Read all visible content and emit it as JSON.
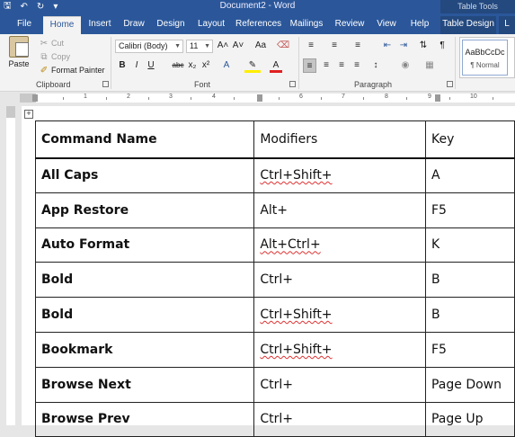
{
  "titlebar": {
    "doc_title": "Document2 - Word",
    "context_label": "Table Tools",
    "qat": [
      "save-icon",
      "undo-icon",
      "redo-icon",
      "customize-icon"
    ]
  },
  "tabs": [
    {
      "label": "File"
    },
    {
      "label": "Home",
      "active": true
    },
    {
      "label": "Insert"
    },
    {
      "label": "Draw"
    },
    {
      "label": "Design"
    },
    {
      "label": "Layout"
    },
    {
      "label": "References"
    },
    {
      "label": "Mailings"
    },
    {
      "label": "Review"
    },
    {
      "label": "View"
    },
    {
      "label": "Help"
    },
    {
      "label": "Table Design",
      "context": true
    },
    {
      "label": "L",
      "context": true
    }
  ],
  "ribbon": {
    "clipboard": {
      "label": "Clipboard",
      "paste": "Paste",
      "cut": "Cut",
      "copy": "Copy",
      "format_painter": "Format Painter"
    },
    "font": {
      "label": "Font",
      "font_name": "Calibri (Body)",
      "font_size": "11",
      "grow": "A˄",
      "shrink": "A˅",
      "change_case": "Aa",
      "bold": "B",
      "italic": "I",
      "underline": "U",
      "strikethrough": "abc",
      "subscript": "x₂",
      "superscript": "x²",
      "text_effects": "A",
      "font_color": "A"
    },
    "paragraph": {
      "label": "Paragraph"
    },
    "styles": {
      "sample": "AaBbCcDc",
      "name": "¶ Normal"
    }
  },
  "ruler": {
    "numbers": [
      "1",
      "2",
      "3",
      "4",
      "5",
      "6",
      "7",
      "8",
      "9",
      "10"
    ]
  },
  "table": {
    "headers": [
      "Command Name",
      "Modifiers",
      "Key"
    ],
    "rows": [
      {
        "name": "All Caps",
        "modifiers": "Ctrl+Shift+",
        "key": "A"
      },
      {
        "name": "App Restore",
        "modifiers": "Alt+",
        "key": "F5"
      },
      {
        "name": "Auto Format",
        "modifiers": "Alt+Ctrl+",
        "key": "K"
      },
      {
        "name": "Bold",
        "modifiers": "Ctrl+",
        "key": "B"
      },
      {
        "name": "Bold",
        "modifiers": "Ctrl+Shift+",
        "key": "B"
      },
      {
        "name": "Bookmark",
        "modifiers": "Ctrl+Shift+",
        "key": "F5"
      },
      {
        "name": "Browse Next",
        "modifiers": "Ctrl+",
        "key": "Page Down"
      },
      {
        "name": "Browse Prev",
        "modifiers": "Ctrl+",
        "key": "Page Up"
      }
    ]
  },
  "colors": {
    "accent": "#2b579a",
    "ribbon_bg": "#f3f3f3",
    "spellcheck": "#d33333"
  }
}
